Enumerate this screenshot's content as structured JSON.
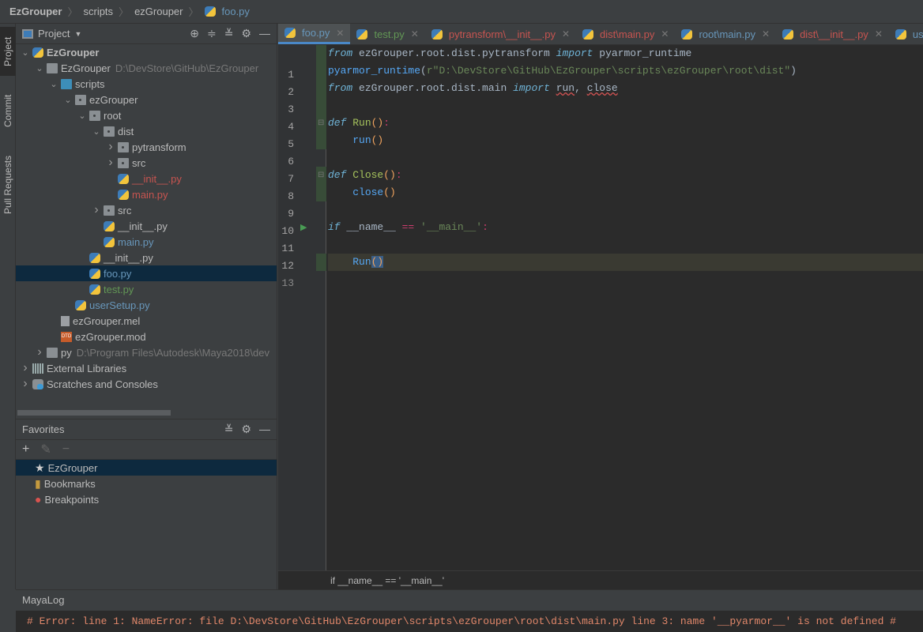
{
  "breadcrumb": [
    "EzGrouper",
    "scripts",
    "ezGrouper",
    "foo.py"
  ],
  "side_tabs": [
    "Project",
    "Commit",
    "Pull Requests"
  ],
  "project": {
    "title": "Project",
    "tree": [
      {
        "level": 0,
        "chev": "v",
        "icon": "py",
        "label": "EzGrouper",
        "bold": true,
        "color": "#bbbbbb"
      },
      {
        "level": 1,
        "chev": "v",
        "icon": "folder",
        "label": "EzGrouper",
        "hint": "D:\\DevStore\\GitHub\\EzGrouper",
        "color": "#bbbbbb"
      },
      {
        "level": 2,
        "chev": "v",
        "icon": "folder-blue",
        "label": "scripts",
        "color": "#bbbbbb"
      },
      {
        "level": 3,
        "chev": "v",
        "icon": "pkg",
        "label": "ezGrouper",
        "color": "#bbbbbb"
      },
      {
        "level": 4,
        "chev": "v",
        "icon": "pkg",
        "label": "root",
        "color": "#bbbbbb"
      },
      {
        "level": 5,
        "chev": "v",
        "icon": "pkg",
        "label": "dist",
        "color": "#bbbbbb"
      },
      {
        "level": 6,
        "chev": ">",
        "icon": "pkg",
        "label": "pytransform",
        "color": "#bbbbbb"
      },
      {
        "level": 6,
        "chev": ">",
        "icon": "pkg",
        "label": "src",
        "color": "#bbbbbb"
      },
      {
        "level": 6,
        "chev": "",
        "icon": "py",
        "label": "__init__.py",
        "color": "#c75450"
      },
      {
        "level": 6,
        "chev": "",
        "icon": "py",
        "label": "main.py",
        "color": "#c75450"
      },
      {
        "level": 5,
        "chev": ">",
        "icon": "pkg",
        "label": "src",
        "color": "#bbbbbb"
      },
      {
        "level": 5,
        "chev": "",
        "icon": "py",
        "label": "__init__.py",
        "color": "#bbbbbb"
      },
      {
        "level": 5,
        "chev": "",
        "icon": "py",
        "label": "main.py",
        "color": "#6897bb"
      },
      {
        "level": 4,
        "chev": "",
        "icon": "py",
        "label": "__init__.py",
        "color": "#bbbbbb"
      },
      {
        "level": 4,
        "chev": "",
        "icon": "py",
        "label": "foo.py",
        "color": "#6897bb",
        "selected": true
      },
      {
        "level": 4,
        "chev": "",
        "icon": "py",
        "label": "test.py",
        "color": "#629755"
      },
      {
        "level": 3,
        "chev": "",
        "icon": "py",
        "label": "userSetup.py",
        "color": "#6897bb"
      },
      {
        "level": 2,
        "chev": "",
        "icon": "file",
        "label": "ezGrouper.mel",
        "color": "#bbbbbb"
      },
      {
        "level": 2,
        "chev": "",
        "icon": "dtd",
        "label": "ezGrouper.mod",
        "color": "#bbbbbb"
      },
      {
        "level": 1,
        "chev": ">",
        "icon": "folder",
        "label": "py",
        "hint": "D:\\Program Files\\Autodesk\\Maya2018\\dev",
        "color": "#bbbbbb"
      },
      {
        "level": 0,
        "chev": ">",
        "icon": "lib",
        "label": "External Libraries",
        "color": "#bbbbbb"
      },
      {
        "level": 0,
        "chev": ">",
        "icon": "scratch",
        "label": "Scratches and Consoles",
        "color": "#bbbbbb"
      }
    ]
  },
  "favorites": {
    "title": "Favorites",
    "items": [
      {
        "icon": "star",
        "label": "EzGrouper",
        "selected": true
      },
      {
        "icon": "bookmark",
        "label": "Bookmarks"
      },
      {
        "icon": "breakpoint",
        "label": "Breakpoints"
      }
    ]
  },
  "tabs": [
    {
      "label": "foo.py",
      "color": "#6897bb",
      "active": true
    },
    {
      "label": "test.py",
      "color": "#629755"
    },
    {
      "label": "pytransform\\__init__.py",
      "color": "#c75450"
    },
    {
      "label": "dist\\main.py",
      "color": "#c75450"
    },
    {
      "label": "root\\main.py",
      "color": "#6897bb"
    },
    {
      "label": "dist\\__init__.py",
      "color": "#c75450"
    },
    {
      "label": "userSetup.py",
      "color": "#6897bb"
    }
  ],
  "code_lines": [
    "<span class=kw>from</span> ezGrouper.root.dist.pytransform <span class=kw>import</span> pyarmor_runtime",
    "<span class=call>pyarmor_runtime</span>(<span class=str>r\"D:\\DevStore\\GitHub\\EzGrouper\\scripts\\ezGrouper\\root\\dist\"</span>)",
    "<span class=kw>from</span> ezGrouper.root.dist.main <span class=kw>import</span> <span class=err>run</span>, <span class=err>close</span>",
    "",
    "<span class=kw>def</span> <span class=fn>Run</span><span class=par>()</span><span class=op>:</span>",
    "    <span class=call>run</span><span class=par>()</span>",
    "",
    "<span class=kw>def</span> <span class=fn>Close</span><span class=par>()</span><span class=op>:</span>",
    "    <span class=call>close</span><span class=par>()</span>",
    "",
    "<span class=kw>if</span> __name__ <span class=op>==</span> <span class=str>'__main__'</span><span class=op>:</span>",
    "",
    "    <span class=call>Run</span><span class=match><span class=par>()</span></span>"
  ],
  "code_breadcrumb": "if __name__ == '__main__'",
  "log": {
    "title": "MayaLog",
    "line": "# Error: line 1: NameError: file D:\\DevStore\\GitHub\\EzGrouper\\scripts\\ezGrouper\\root\\dist\\main.py line 3: name '__pyarmor__' is not defined #"
  }
}
